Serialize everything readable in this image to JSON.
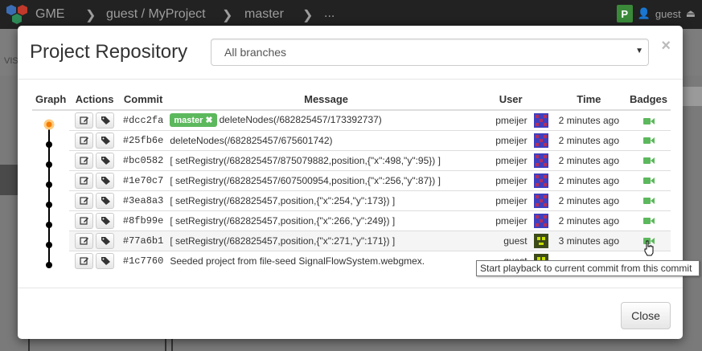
{
  "navbar": {
    "app_name": "GME",
    "project": "guest / MyProject",
    "branch": "master",
    "ellipsis": "...",
    "user_badge": "P",
    "user": "guest",
    "eject_icon": "eject-icon"
  },
  "background": {
    "vis_label": "VIS"
  },
  "modal": {
    "title": "Project Repository",
    "branch_select": {
      "value": "All branches",
      "caret_icon": "caret-down-icon"
    },
    "close_label": "×",
    "footer_close_label": "Close"
  },
  "table": {
    "headers": [
      "Graph",
      "Actions",
      "Commit",
      "Message",
      "User",
      "Time",
      "Badges"
    ],
    "rows": [
      {
        "commit": "#dcc2fa",
        "branch_label": "master",
        "message": "deleteNodes(/682825457/173392737)",
        "user": "pmeijer",
        "time": "2 minutes ago"
      },
      {
        "commit": "#25fb6e",
        "branch_label": "",
        "message": "deleteNodes(/682825457/675601742)",
        "user": "pmeijer",
        "time": "2 minutes ago"
      },
      {
        "commit": "#bc0582",
        "branch_label": "",
        "message": "[ setRegistry(/682825457/875079882,position,{\"x\":498,\"y\":95}) ]",
        "user": "pmeijer",
        "time": "2 minutes ago"
      },
      {
        "commit": "#1e70c7",
        "branch_label": "",
        "message": "[ setRegistry(/682825457/607500954,position,{\"x\":256,\"y\":87}) ]",
        "user": "pmeijer",
        "time": "2 minutes ago"
      },
      {
        "commit": "#3ea8a3",
        "branch_label": "",
        "message": "[ setRegistry(/682825457,position,{\"x\":254,\"y\":173}) ]",
        "user": "pmeijer",
        "time": "2 minutes ago"
      },
      {
        "commit": "#8fb99e",
        "branch_label": "",
        "message": "[ setRegistry(/682825457,position,{\"x\":266,\"y\":249}) ]",
        "user": "pmeijer",
        "time": "2 minutes ago"
      },
      {
        "commit": "#77a6b1",
        "branch_label": "",
        "message": "[ setRegistry(/682825457,position,{\"x\":271,\"y\":171}) ]",
        "user": "guest",
        "time": "3 minutes ago"
      },
      {
        "commit": "#1c7760",
        "branch_label": "",
        "message": "Seeded project from file-seed SignalFlowSystem.webgmex.",
        "user": "guest",
        "time": "",
        "time_hidden_under_tooltip": true
      }
    ]
  },
  "tooltip": {
    "text": "Start playback to current commit from this commit"
  },
  "colors": {
    "master_label": "#5cb85c",
    "head_node": "#f57c00",
    "badge_camera": "#5cb85c",
    "pmeijer_avatar": "#3f3fbf",
    "guest_avatar": "#3d4a1a"
  }
}
